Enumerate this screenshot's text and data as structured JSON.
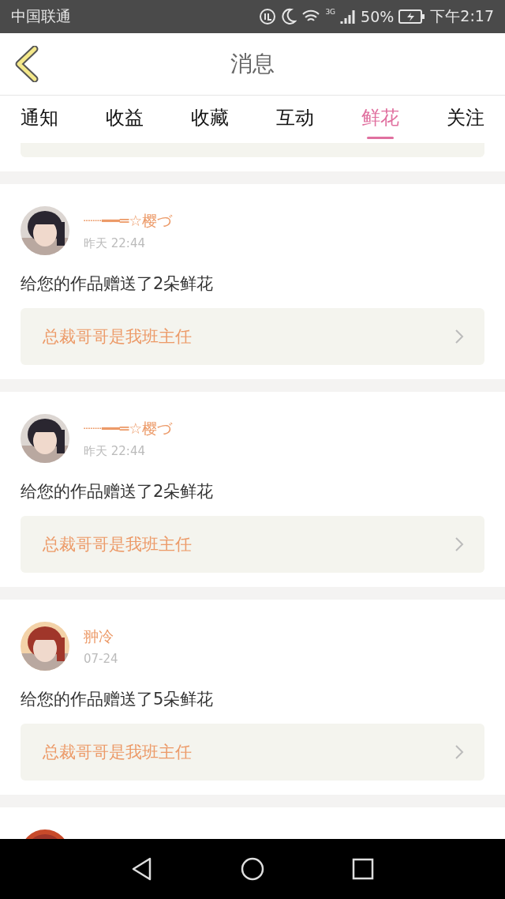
{
  "status_bar": {
    "carrier": "中国联通",
    "network": "3G",
    "battery": "50%",
    "time": "下午2:17"
  },
  "header": {
    "title": "消息"
  },
  "tabs": [
    {
      "label": "通知",
      "selected": false
    },
    {
      "label": "收益",
      "selected": false
    },
    {
      "label": "收藏",
      "selected": false
    },
    {
      "label": "互动",
      "selected": false
    },
    {
      "label": "鲜花",
      "selected": true
    },
    {
      "label": "关注",
      "selected": false
    }
  ],
  "messages": [
    {
      "kind": "stub"
    },
    {
      "kind": "full",
      "name": "┈┈━━═☆樱づ",
      "time": "昨天 22:44",
      "text": "给您的作品赠送了2朵鲜花",
      "work": "总裁哥哥是我班主任"
    },
    {
      "kind": "full",
      "name": "┈┈━━═☆樱づ",
      "time": "昨天 22:44",
      "text": "给您的作品赠送了2朵鲜花",
      "work": "总裁哥哥是我班主任"
    },
    {
      "kind": "full",
      "name": "翀冷",
      "time": "07-24",
      "text": "给您的作品赠送了5朵鲜花",
      "work": "总裁哥哥是我班主任"
    },
    {
      "kind": "cut"
    }
  ]
}
